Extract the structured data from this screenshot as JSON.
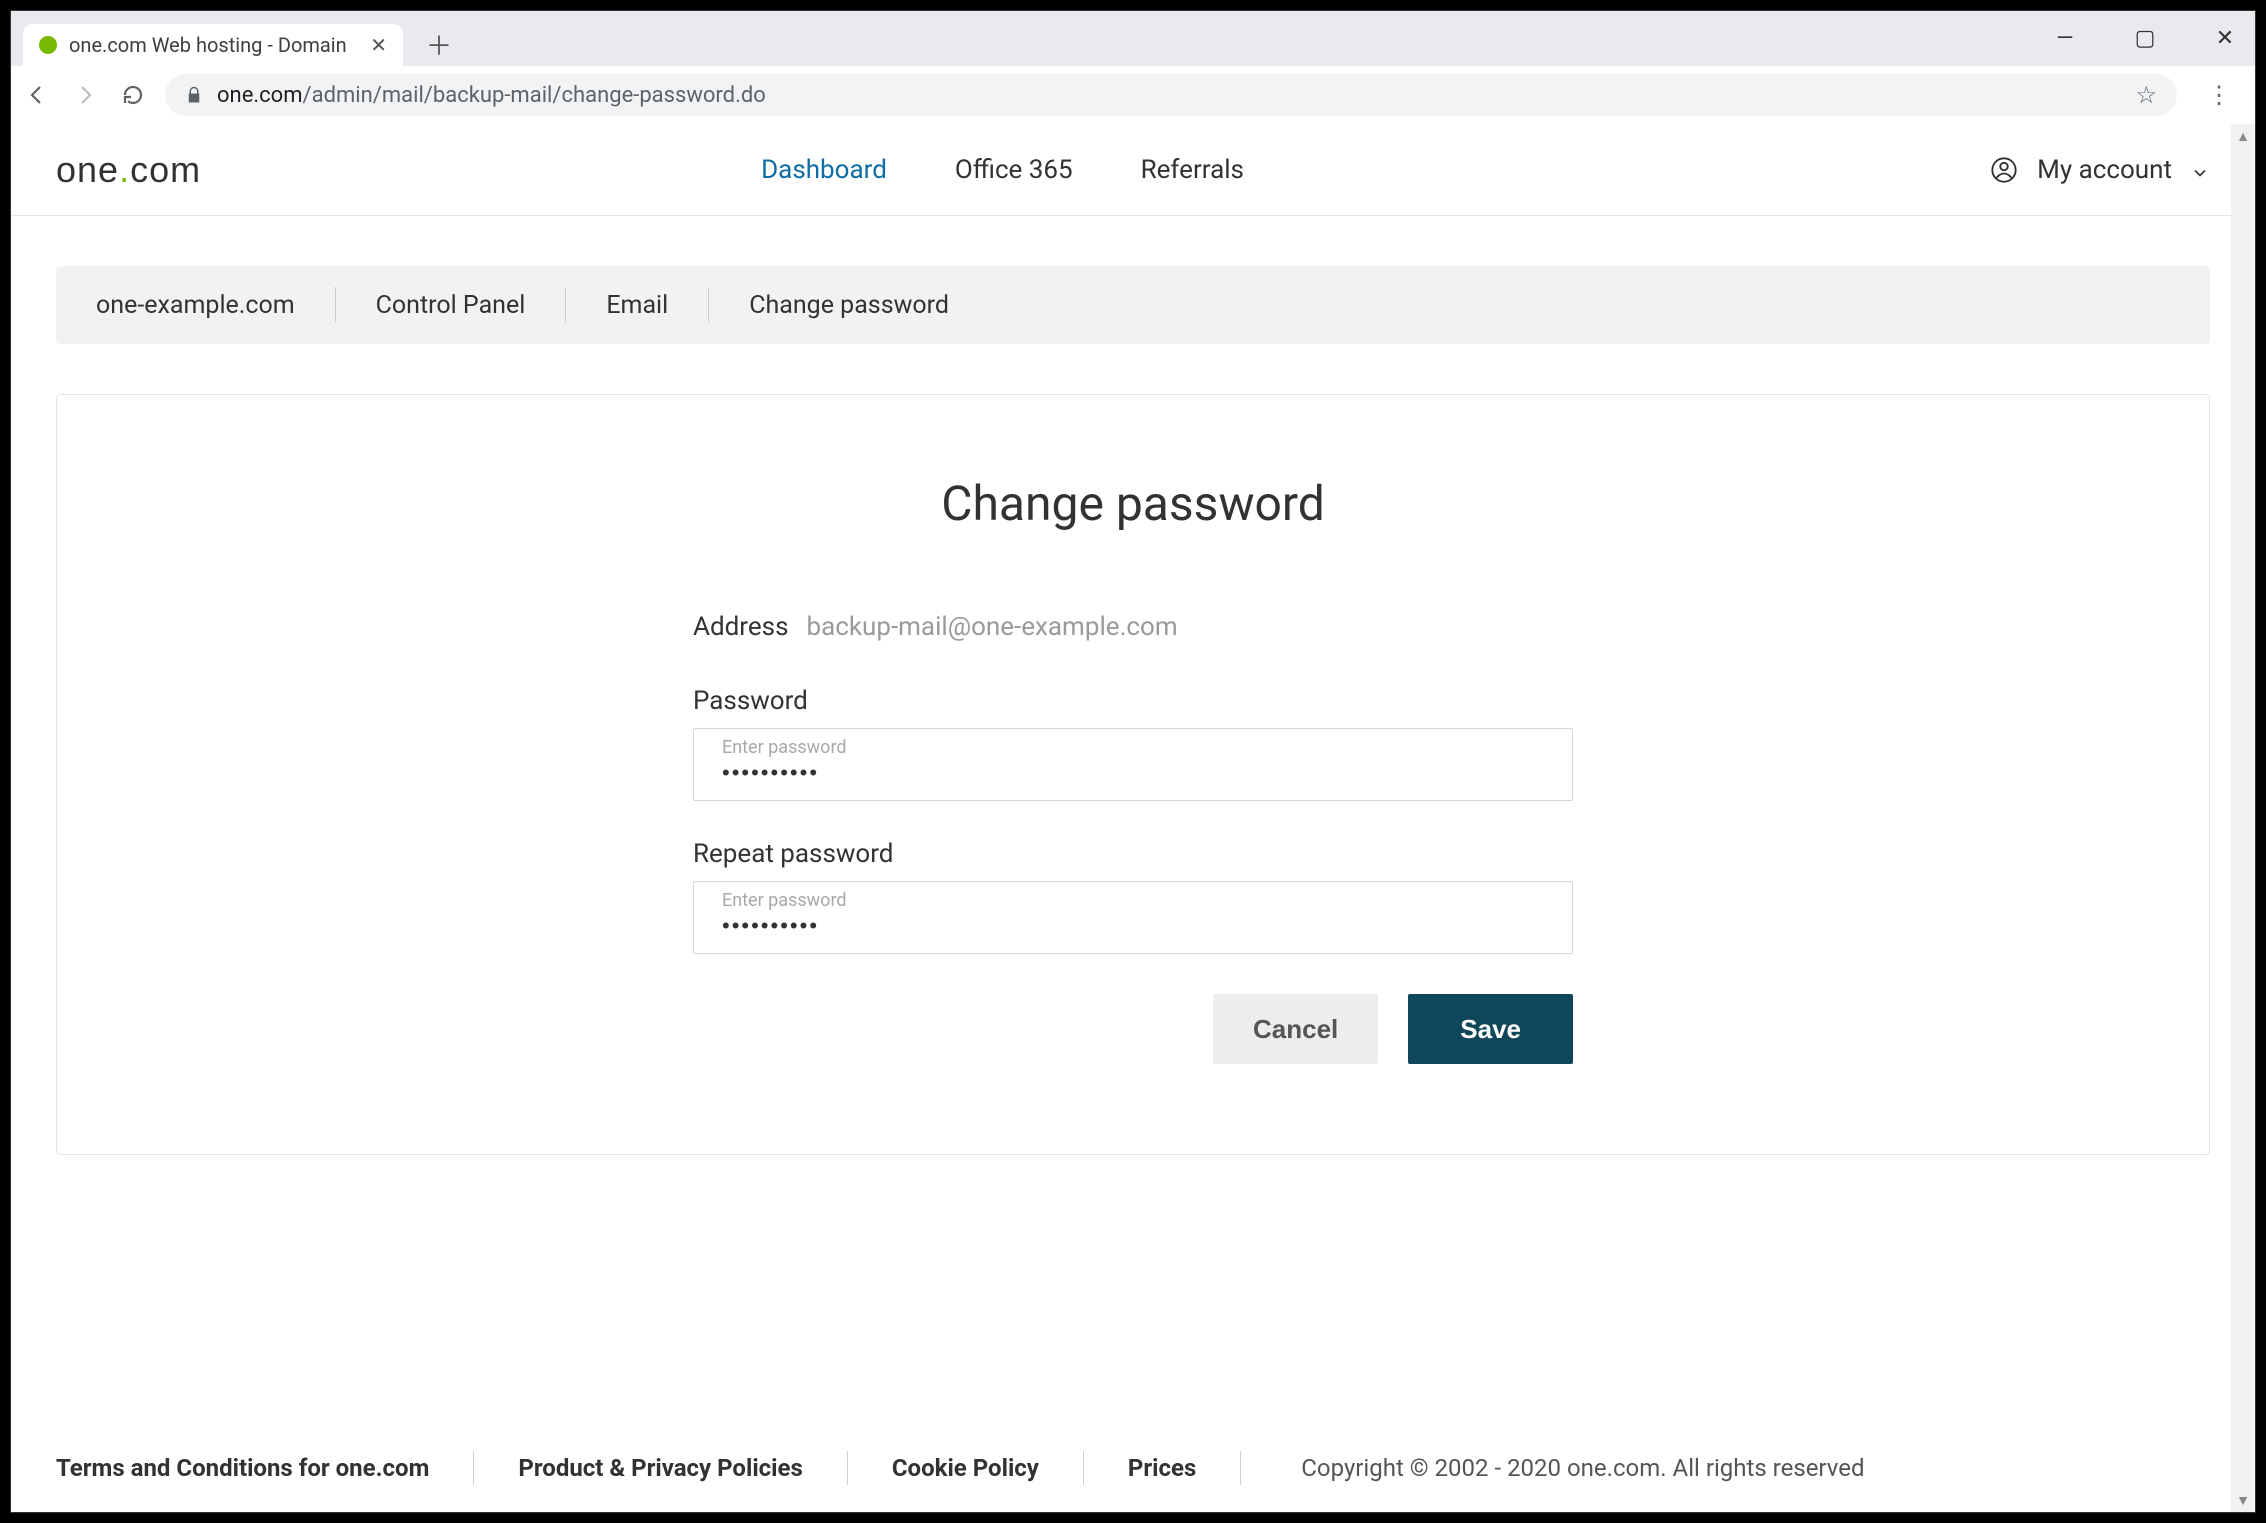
{
  "browser": {
    "tab_title": "one.com Web hosting  -  Domain",
    "url_host": "one.com",
    "url_path": "/admin/mail/backup-mail/change-password.do"
  },
  "header": {
    "logo_text_1": "one",
    "logo_dot": ".",
    "logo_text_2": "com",
    "nav": {
      "dashboard": "Dashboard",
      "office365": "Office 365",
      "referrals": "Referrals"
    },
    "account_label": "My account"
  },
  "breadcrumb": {
    "items": [
      "one-example.com",
      "Control Panel",
      "Email",
      "Change password"
    ]
  },
  "form": {
    "title": "Change password",
    "address_label": "Address",
    "address_value": "backup-mail@one-example.com",
    "password_label": "Password",
    "password_floating": "Enter password",
    "password_value": "••••••••••",
    "repeat_label": "Repeat password",
    "repeat_floating": "Enter password",
    "repeat_value": "••••••••••",
    "cancel": "Cancel",
    "save": "Save"
  },
  "footer": {
    "links": [
      "Terms and Conditions for one.com",
      "Product & Privacy Policies",
      "Cookie Policy",
      "Prices"
    ],
    "copyright": "Copyright © 2002 - 2020 one.com. All rights reserved"
  }
}
